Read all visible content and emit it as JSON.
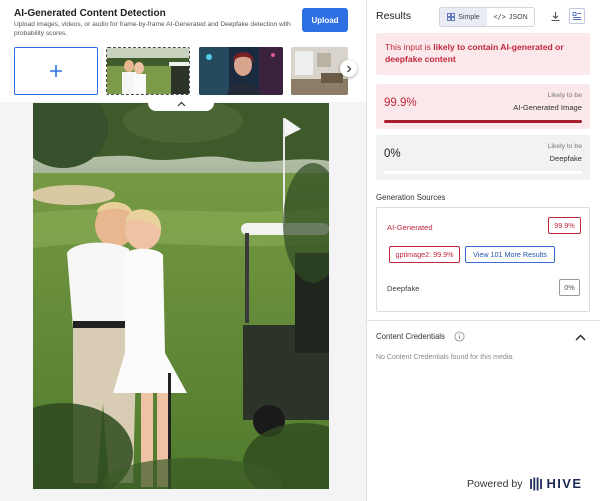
{
  "header": {
    "title": "AI-Generated Content Detection",
    "description": "Upload images, videos, or audio for frame-by-frame AI-Generated and Deepfake detection with probability scores.",
    "upload_label": "Upload"
  },
  "carousel": {
    "add_symbol": "+",
    "thumbnails": [
      {
        "name": "golf-couple-thumbnail",
        "selected": true
      },
      {
        "name": "cyberpunk-woman-thumbnail",
        "selected": false
      },
      {
        "name": "interior-room-thumbnail",
        "selected": false
      }
    ]
  },
  "results": {
    "title": "Results",
    "view_modes": [
      {
        "label": "Simple",
        "icon": "grid-icon",
        "active": true
      },
      {
        "label": "JSON",
        "icon": "code-icon",
        "active": false
      }
    ],
    "verdict": {
      "prefix": "This input is ",
      "emphasis": "likely to contain AI-generated or deepfake content"
    },
    "scores": [
      {
        "value": "99.9%",
        "caption": "Likely to be",
        "label": "AI-Generated Image",
        "fraction": 0.999,
        "color": "#a71c2e"
      },
      {
        "value": "0%",
        "caption": "Likely to be",
        "label": "Deepfake",
        "fraction": 0.0,
        "color": "#a71c2e"
      }
    ],
    "generation_sources": {
      "title": "Generation Sources",
      "ai_label": "AI-Generated",
      "ai_value": "99.9%",
      "source_chip": "gptimage2: 99.9%",
      "more_results": "View 101 More Results",
      "deepfake_label": "Deepfake",
      "deepfake_value": "0%"
    },
    "content_credentials": {
      "title": "Content Credentials",
      "empty_text": "No Content Credentials found for this media."
    }
  },
  "footer": {
    "powered_by": "Powered by",
    "brand": "HIVE"
  },
  "colors": {
    "accent_blue": "#2f6fe4",
    "danger_red": "#c0283e",
    "danger_bg": "#fbe8ea",
    "brand_navy": "#1d2b57"
  }
}
